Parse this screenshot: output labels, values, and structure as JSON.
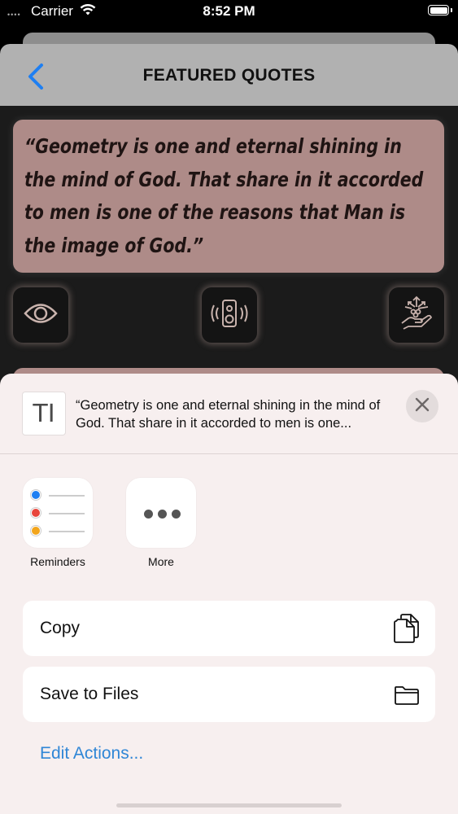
{
  "status_bar": {
    "signal": "••••",
    "carrier": "Carrier",
    "time": "8:52 PM"
  },
  "nav": {
    "title": "FEATURED QUOTES",
    "back_icon": "chevron-left-icon"
  },
  "quote": {
    "text": "“Geometry is one and eternal shining in the mind of God. That share in it accorded to men is one of the reasons that Man is the image of God.”"
  },
  "quote_actions": [
    {
      "icon": "eye-icon"
    },
    {
      "icon": "speaker-icon"
    },
    {
      "icon": "share-hand-icon"
    }
  ],
  "share_sheet": {
    "preview_text": "“Geometry is one and eternal shining in the mind of God. That share in it accorded to men is one...",
    "preview_icon": "text-document-icon",
    "preview_glyph": "TI",
    "apps": [
      {
        "label": "Reminders",
        "icon": "reminders-icon"
      },
      {
        "label": "More",
        "icon": "more-icon"
      }
    ],
    "actions": [
      {
        "label": "Copy",
        "icon": "copy-icon"
      },
      {
        "label": "Save to Files",
        "icon": "folder-icon"
      }
    ],
    "edit_actions": "Edit Actions..."
  },
  "colors": {
    "accent": "#2f86d6",
    "quote_card": "#ae8b88",
    "nav_bar": "#b1b1b1",
    "reminder_blue": "#1e7ff2",
    "reminder_red": "#e8463c",
    "reminder_orange": "#f2a51c"
  }
}
